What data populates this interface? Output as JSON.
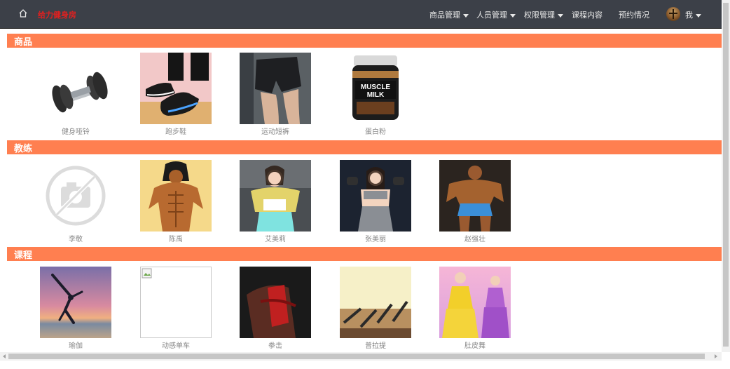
{
  "nav": {
    "brand": "给力健身房",
    "menus": [
      {
        "label": "商品管理",
        "has_dropdown": true
      },
      {
        "label": "人员管理",
        "has_dropdown": true
      },
      {
        "label": "权限管理",
        "has_dropdown": true
      },
      {
        "label": "课程内容",
        "has_dropdown": false
      },
      {
        "label": "预约情况",
        "has_dropdown": false
      }
    ],
    "user_label": "我"
  },
  "sections": [
    {
      "title": "商品",
      "items": [
        {
          "caption": "健身哑铃",
          "icon": "dumbbell"
        },
        {
          "caption": "跑步鞋",
          "icon": "running-shoes"
        },
        {
          "caption": "运动短裤",
          "icon": "sport-shorts"
        },
        {
          "caption": "蛋白粉",
          "icon": "protein-tub"
        }
      ]
    },
    {
      "title": "教练",
      "items": [
        {
          "caption": "李敬",
          "icon": "no-photo"
        },
        {
          "caption": "陈禹",
          "icon": "coach-photo"
        },
        {
          "caption": "艾美莉",
          "icon": "coach-photo"
        },
        {
          "caption": "张美丽",
          "icon": "coach-photo"
        },
        {
          "caption": "赵强壮",
          "icon": "coach-photo"
        }
      ]
    },
    {
      "title": "课程",
      "items": [
        {
          "caption": "瑜伽",
          "icon": "yoga-photo"
        },
        {
          "caption": "动感单车",
          "icon": "broken-image"
        },
        {
          "caption": "拳击",
          "icon": "boxing-photo"
        },
        {
          "caption": "普拉提",
          "icon": "pilates-photo"
        },
        {
          "caption": "肚皮舞",
          "icon": "bellydance-photo"
        }
      ]
    }
  ],
  "colors": {
    "navbar_bg": "#3c4048",
    "section_bar": "#ff7f50",
    "brand_text": "#e02020",
    "caption_text": "#888888"
  }
}
